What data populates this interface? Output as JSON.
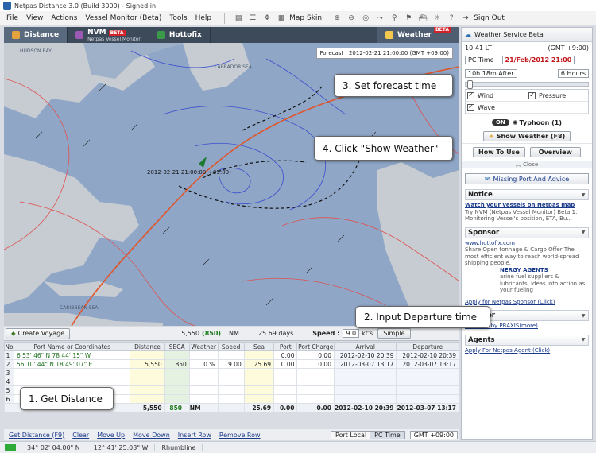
{
  "window": {
    "title": "Netpas Distance 3.0 (Build 3000) - Signed in"
  },
  "menu": {
    "items": [
      "File",
      "View",
      "Actions",
      "Vessel Monitor (Beta)",
      "Tools",
      "Help"
    ],
    "map_skin": "Map Skin",
    "sign_out": "Sign Out"
  },
  "tabs": {
    "distance": "Distance",
    "nvm": "NVM",
    "nvm_sub": "Netpas Vessel Monitor",
    "nvm_badge": "BETA",
    "hottofix": "Hottofix",
    "weather": "Weather",
    "weather_badge": "BETA"
  },
  "map": {
    "forecast": "Forecast : 2012-02-21 21:00:00 (GMT +09:00)",
    "ship_time": "2012-02-21 21:00:00(+09:00)",
    "labels": {
      "hudson_bay": "HUDSON BAY",
      "labrador": "LABRADOR SEA",
      "caribbean": "CARIBBEAN SEA"
    }
  },
  "callouts": {
    "c1": "1. Get Distance",
    "c2": "2. Input Departure time",
    "c3": "3. Set forecast time",
    "c4": "4. Click \"Show Weather\""
  },
  "voyage_bar": {
    "create": "Create Voyage",
    "distance": "5,550",
    "seca": "(850)",
    "nm": "NM",
    "days": "25.69 days",
    "speed_label": "Speed :",
    "speed": "9.0",
    "kts": "kt's",
    "simple": "Simple"
  },
  "grid": {
    "headers": [
      "No",
      "Port Name or Coordinates",
      "Distance",
      "SECA",
      "Weather",
      "Speed",
      "Sea",
      "Port",
      "Port Charge",
      "Arrival",
      "Departure"
    ],
    "rows": [
      {
        "no": "1",
        "port": "6 53' 46\" N  78 44' 15\" W",
        "distance": "",
        "seca": "",
        "weather": "",
        "speed": "",
        "sea": "",
        "port_days": "0.00",
        "charge": "0.00",
        "arrival": "2012-02-10 20:39",
        "departure": "2012-02-10 20:39"
      },
      {
        "no": "2",
        "port": "56 10' 44\" N  18 49' 07\" E",
        "distance": "5,550",
        "seca": "850",
        "weather": "0 %",
        "speed": "9.00",
        "sea": "25.69",
        "port_days": "0.00",
        "charge": "0.00",
        "arrival": "2012-03-07 13:17",
        "departure": "2012-03-07 13:17"
      },
      {
        "no": "3",
        "port": "",
        "distance": "",
        "seca": "",
        "weather": "",
        "speed": "",
        "sea": "",
        "port_days": "",
        "charge": "",
        "arrival": "",
        "departure": ""
      },
      {
        "no": "4",
        "port": "",
        "distance": "",
        "seca": "",
        "weather": "",
        "speed": "",
        "sea": "",
        "port_days": "",
        "charge": "",
        "arrival": "",
        "departure": ""
      },
      {
        "no": "5",
        "port": "",
        "distance": "",
        "seca": "",
        "weather": "",
        "speed": "",
        "sea": "",
        "port_days": "",
        "charge": "",
        "arrival": "",
        "departure": ""
      },
      {
        "no": "6",
        "port": "",
        "distance": "",
        "seca": "",
        "weather": "",
        "speed": "",
        "sea": "",
        "port_days": "",
        "charge": "",
        "arrival": "",
        "departure": ""
      }
    ],
    "total": {
      "label": "Total",
      "distance": "5,550",
      "seca": "850",
      "nm": "NM",
      "sea": "25.69",
      "port_days": "0.00",
      "charge": "0.00",
      "arrival": "2012-02-10 20:39",
      "departure": "2012-03-07 13:17"
    }
  },
  "actions": {
    "get_distance": "Get Distance (F9)",
    "clear": "Clear",
    "move_up": "Move Up",
    "move_down": "Move Down",
    "insert_row": "Insert Row",
    "remove_row": "Remove Row",
    "port_local": "Port Local",
    "pc_time": "PC Time",
    "timezone": "GMT +09:00"
  },
  "status": {
    "lat": "34° 02' 04.00\" N",
    "lon": "12° 41' 25.03\" W",
    "mode": "Rhumbline"
  },
  "weather_panel": {
    "title": "Weather Service Beta",
    "local_time": "10:41 LT",
    "gmt": "(GMT +9:00)",
    "time_mode": "PC Time",
    "date": "21/Feb/2012 21:00",
    "after": "10h 18m After",
    "interval": "6 Hours",
    "wind": "Wind",
    "pressure": "Pressure",
    "wave": "Wave",
    "on": "ON",
    "typhoon": "Typhoon (1)",
    "show_weather": "Show Weather (F8)",
    "how_to_use": "How To Use",
    "overview": "Overview",
    "close": "Close"
  },
  "side": {
    "missing": "Missing Port And Advice",
    "notice": "Notice",
    "notice_title": "Watch your vessels on Netpas map",
    "notice_text": "Try NVM (Netpas Vessel Monitor) Beta 1. Monitoring Vessel's position, ETA, Bu...",
    "sponsor": "Sponsor",
    "sponsor_link": "www.hottofix.com",
    "sponsor_text": "Share Open tonnage & Cargo Offer The most efficient way to reach world-spread shipping people.",
    "sponsor2_title": "NERGY AGENTS",
    "sponsor2_text": "arine fuel suppliers & lubricants. ideas into action as your fueling",
    "apply_sponsor": "Apply for Netpas Sponsor (Click)",
    "bunker": "Bunker",
    "praxis": "Provided by PRAXIS(more)",
    "agents": "Agents",
    "apply_agent": "Apply For Netpas Agent (Click)"
  }
}
